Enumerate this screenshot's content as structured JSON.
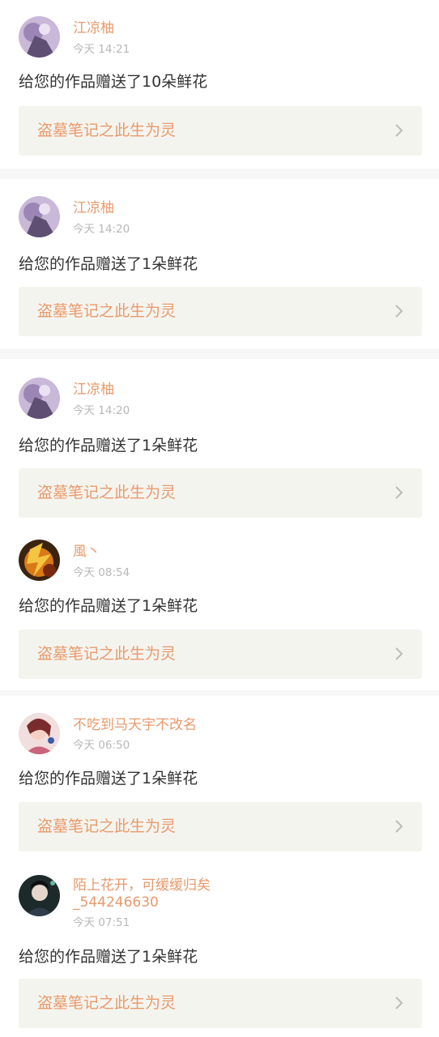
{
  "colors": {
    "username": "#e89a6c",
    "work_title": "#e89a6c",
    "timestamp": "#b8b8b8",
    "message": "#333333",
    "work_bg": "#f4f4ef",
    "separator": "#f7f7f8"
  },
  "notifications": [
    {
      "username": "江凉柚",
      "time": "今天 14:21",
      "message": "给您的作品赠送了10朵鲜花",
      "work_title": "盗墓笔记之此生为灵",
      "avatar_icon": "avatar-purple-icon",
      "chevron_icon": "chevron-right-icon"
    },
    {
      "username": "江凉柚",
      "time": "今天 14:20",
      "message": "给您的作品赠送了1朵鲜花",
      "work_title": "盗墓笔记之此生为灵",
      "avatar_icon": "avatar-purple-icon",
      "chevron_icon": "chevron-right-icon"
    },
    {
      "username": "江凉柚",
      "time": "今天 14:20",
      "message": "给您的作品赠送了1朵鲜花",
      "work_title": "盗墓笔记之此生为灵",
      "avatar_icon": "avatar-purple-icon",
      "chevron_icon": "chevron-right-icon"
    },
    {
      "username": "風丶",
      "time": "今天 08:54",
      "message": "给您的作品赠送了1朵鲜花",
      "work_title": "盗墓笔记之此生为灵",
      "avatar_icon": "avatar-fire-icon",
      "chevron_icon": "chevron-right-icon"
    },
    {
      "username": "不吃到马天宇不改名",
      "time": "今天 06:50",
      "message": "给您的作品赠送了1朵鲜花",
      "work_title": "盗墓笔记之此生为灵",
      "avatar_icon": "avatar-person-icon",
      "chevron_icon": "chevron-right-icon"
    },
    {
      "username": "陌上花开，可缓缓归矣_544246630",
      "time": "今天 07:51",
      "message": "给您的作品赠送了1朵鲜花",
      "work_title": "盗墓笔记之此生为灵",
      "avatar_icon": "avatar-dark-icon",
      "chevron_icon": "chevron-right-icon"
    }
  ]
}
